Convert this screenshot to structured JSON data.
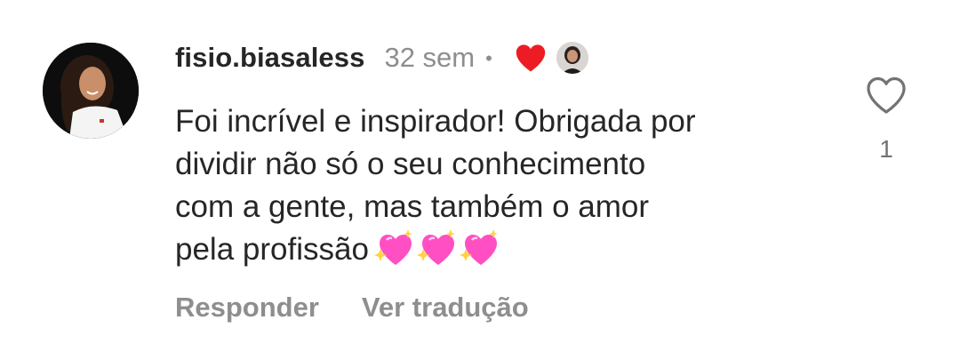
{
  "comment": {
    "username": "fisio.biasaless",
    "time": "32 sem",
    "separator": "•",
    "liked_by_author_icon": "heart-filled-icon",
    "author_avatar": "author-avatar",
    "text_lines": [
      "Foi incrível e inspirador! Obrigada por",
      "dividir não só o seu conhecimento",
      "com a gente, mas também o amor",
      "pela profissão"
    ],
    "emoji": [
      "sparkling-heart-icon",
      "sparkling-heart-icon",
      "sparkling-heart-icon"
    ],
    "like_icon": "heart-outline-icon",
    "like_count": "1"
  },
  "actions": {
    "reply_label": "Responder",
    "translate_label": "Ver tradução"
  },
  "colors": {
    "text": "#262626",
    "muted": "#8e8e8e",
    "liked_heart": "#ed1c24",
    "sparkle_heart": "#ff4fc3"
  }
}
